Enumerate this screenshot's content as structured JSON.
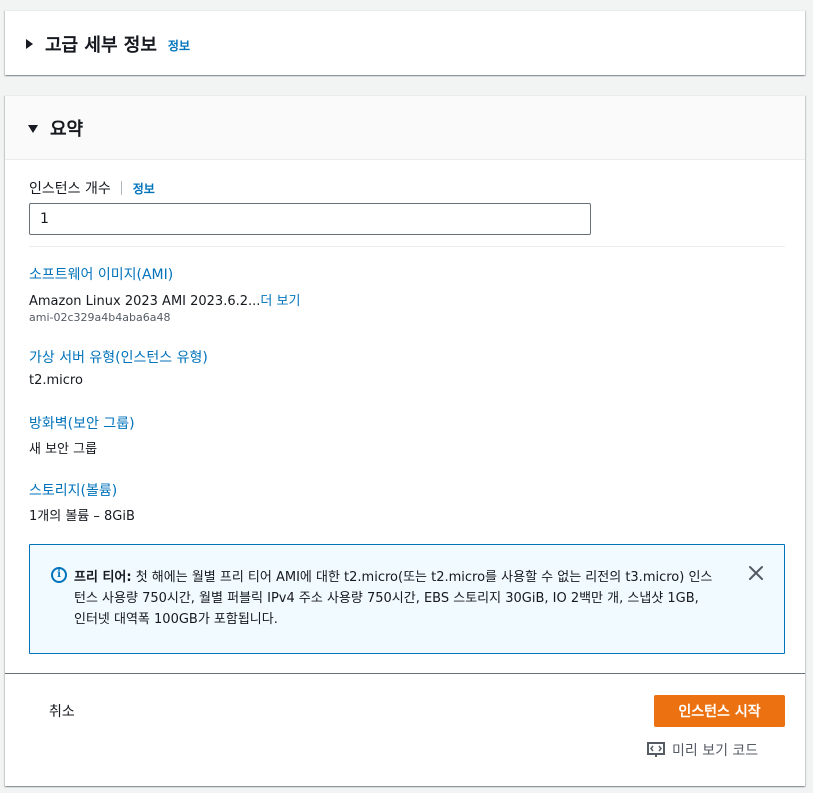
{
  "advanced": {
    "title": "고급 세부 정보",
    "info": "정보"
  },
  "summary": {
    "title": "요약",
    "instance_count": {
      "label": "인스턴스 개수",
      "info": "정보",
      "value": "1"
    },
    "sections": {
      "ami": {
        "title": "소프트웨어 이미지(AMI)",
        "value": "Amazon Linux 2023 AMI 2023.6.2...",
        "more": "더 보기",
        "sub": "ami-02c329a4b4aba6a48"
      },
      "instance_type": {
        "title": "가상 서버 유형(인스턴스 유형)",
        "value": "t2.micro"
      },
      "firewall": {
        "title": "방화벽(보안 그룹)",
        "value": "새 보안 그룹"
      },
      "storage": {
        "title": "스토리지(볼륨)",
        "value": "1개의 볼륨 – 8GiB"
      }
    },
    "alert": {
      "bold": "프리 티어:",
      "text": " 첫 해에는 월별 프리 티어 AMI에 대한 t2.micro(또는 t2.micro를 사용할 수 없는 리전의 t3.micro) 인스턴스 사용량 750시간, 월별 퍼블릭 IPv4 주소 사용량 750시간, EBS 스토리지 30GiB, IO 2백만 개, 스냅샷 1GB, 인터넷 대역폭 100GB가 포함됩니다."
    },
    "footer": {
      "cancel": "취소",
      "launch": "인스턴스 시작",
      "preview": "미리 보기 코드"
    }
  },
  "colors": {
    "link": "#0073bb",
    "primary_button": "#ec7211",
    "alert_bg": "#f1faff"
  }
}
